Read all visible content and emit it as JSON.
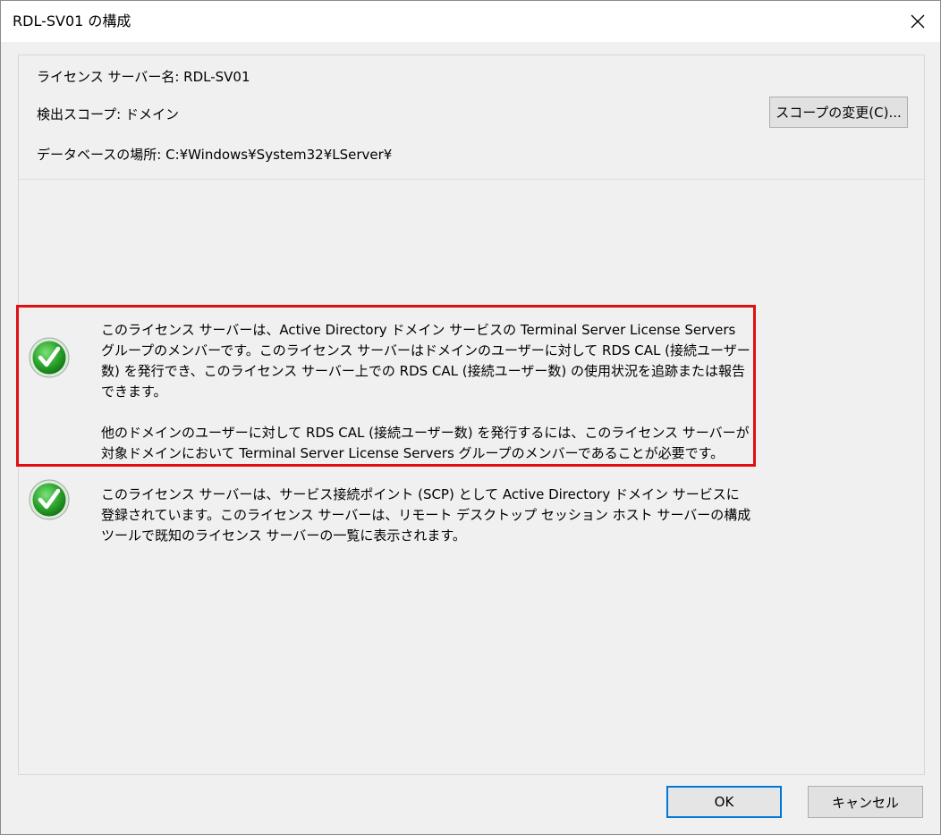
{
  "window": {
    "title": "RDL-SV01 の構成",
    "close_glyph": "✕"
  },
  "info": {
    "server_name_label": "ライセンス サーバー名:",
    "server_name_value": "RDL-SV01",
    "scope_label": "検出スコープ:",
    "scope_value": "ドメイン",
    "db_label": "データベースの場所:",
    "db_value": "C:¥Windows¥System32¥LServer¥",
    "change_scope_button": "スコープの変更(C)..."
  },
  "statuses": [
    {
      "icon": "checkmark-icon",
      "paragraphs": [
        "このライセンス サーバーは、Active Directory ドメイン サービスの Terminal Server License Servers グループのメンバーです。このライセンス サーバーはドメインのユーザーに対して RDS CAL (接続ユーザー数) を発行でき、このライセンス サーバー上での RDS CAL (接続ユーザー数) の使用状況を追跡または報告できます。",
        "他のドメインのユーザーに対して RDS CAL (接続ユーザー数) を発行するには、このライセンス サーバーが対象ドメインにおいて Terminal Server License Servers グループのメンバーであることが必要です。"
      ]
    },
    {
      "icon": "checkmark-icon",
      "paragraphs": [
        "このライセンス サーバーは、サービス接続ポイント (SCP) として Active Directory ドメイン サービスに登録されています。このライセンス サーバーは、リモート デスクトップ セッション ホスト サーバーの構成ツールで既知のライセンス サーバーの一覧に表示されます。"
      ]
    }
  ],
  "footer": {
    "ok_label": "OK",
    "cancel_label": "キャンセル"
  },
  "colors": {
    "highlight": "#e01010",
    "check_green": "#2ea82e",
    "ok_border": "#0078d7"
  }
}
